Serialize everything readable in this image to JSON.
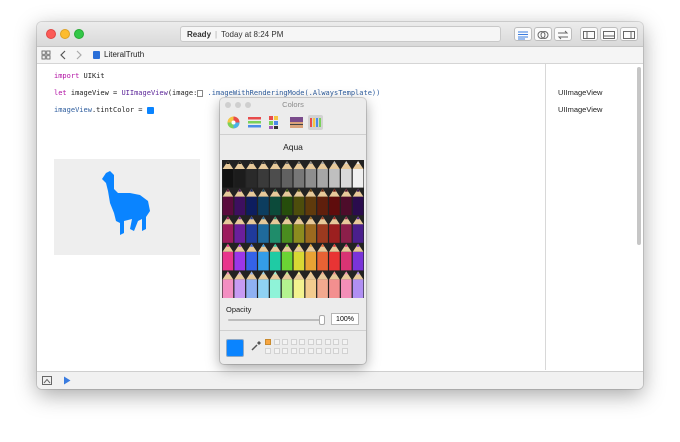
{
  "toolbar": {
    "status_state": "Ready",
    "status_time": "Today at 8:24 PM"
  },
  "jumpbar": {
    "file_name": "LiteralTruth"
  },
  "code": {
    "line1": {
      "kw": "import",
      "rest": " UIKit"
    },
    "line2": {
      "kw": "let",
      "pre": " imageView = ",
      "type": "UIImageView",
      "mid": "(image:",
      "post": " .imageWithRenderingMode(.AlwaysTemplate))"
    },
    "line3": {
      "pre": "imageView",
      "mid": ".tintColor = "
    }
  },
  "results": {
    "r1": "UIImageView",
    "r2": "UIImageView"
  },
  "colors_panel": {
    "title": "Colors",
    "color_name": "Aqua",
    "opacity_label": "Opacity",
    "opacity_value": "100%",
    "selected_color": "#0a84ff",
    "recent_color": "#f7a540"
  },
  "accent": {
    "tint": "#0a84ff"
  }
}
